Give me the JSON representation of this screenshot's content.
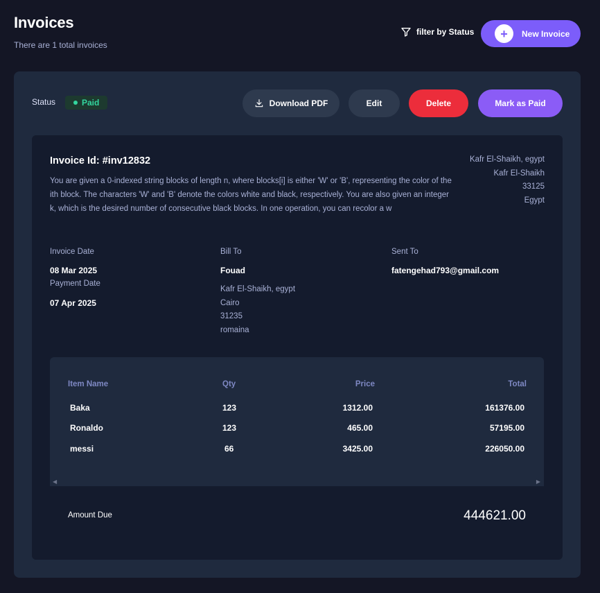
{
  "header": {
    "title": "Invoices",
    "subtitle": "There are 1 total invoices",
    "filter_label": "filter by Status",
    "new_invoice_label": "New Invoice",
    "new_invoice_icon": "+"
  },
  "toolbar": {
    "status_label": "Status",
    "status_value": "Paid",
    "download_label": "Download PDF",
    "edit_label": "Edit",
    "delete_label": "Delete",
    "mark_paid_label": "Mark as Paid"
  },
  "invoice": {
    "id_label": "Invoice Id: #inv12832",
    "description": "You are given a 0-indexed string blocks of length n, where blocks[i] is either 'W' or 'B', representing the color of the ith block. The characters 'W' and 'B' denote the colors white and black, respectively. You are also given an integer k, which is the desired number of consecutive black blocks. In one operation, you can recolor a w",
    "sender": {
      "line1": "Kafr El-Shaikh, egypt",
      "line2": "Kafr El-Shaikh",
      "line3": "33125",
      "line4": "Egypt"
    },
    "invoice_date_label": "Invoice Date",
    "invoice_date": "08 Mar 2025",
    "payment_date_label": "Payment Date",
    "payment_date": "07 Apr 2025",
    "bill_to_label": "Bill To",
    "client_name": "Fouad",
    "client_address": {
      "line1": "Kafr El-Shaikh, egypt",
      "line2": "Cairo",
      "line3": "31235",
      "line4": "romaina"
    },
    "sent_to_label": "Sent To",
    "client_email": "fatengehad793@gmail.com"
  },
  "items": {
    "headers": {
      "name": "Item Name",
      "qty": "Qty",
      "price": "Price",
      "total": "Total"
    },
    "rows": [
      {
        "name": "Baka",
        "qty": "123",
        "price": "1312.00",
        "total": "161376.00"
      },
      {
        "name": "Ronaldo",
        "qty": "123",
        "price": "465.00",
        "total": "57195.00"
      },
      {
        "name": "messi",
        "qty": "66",
        "price": "3425.00",
        "total": "226050.00"
      }
    ]
  },
  "summary": {
    "amount_due_label": "Amount Due",
    "amount_due": "444621.00"
  },
  "colors": {
    "background": "#141625",
    "accent": "#7c5dfa",
    "paid_green": "#33d69f",
    "delete_red": "#ec2d3b"
  }
}
